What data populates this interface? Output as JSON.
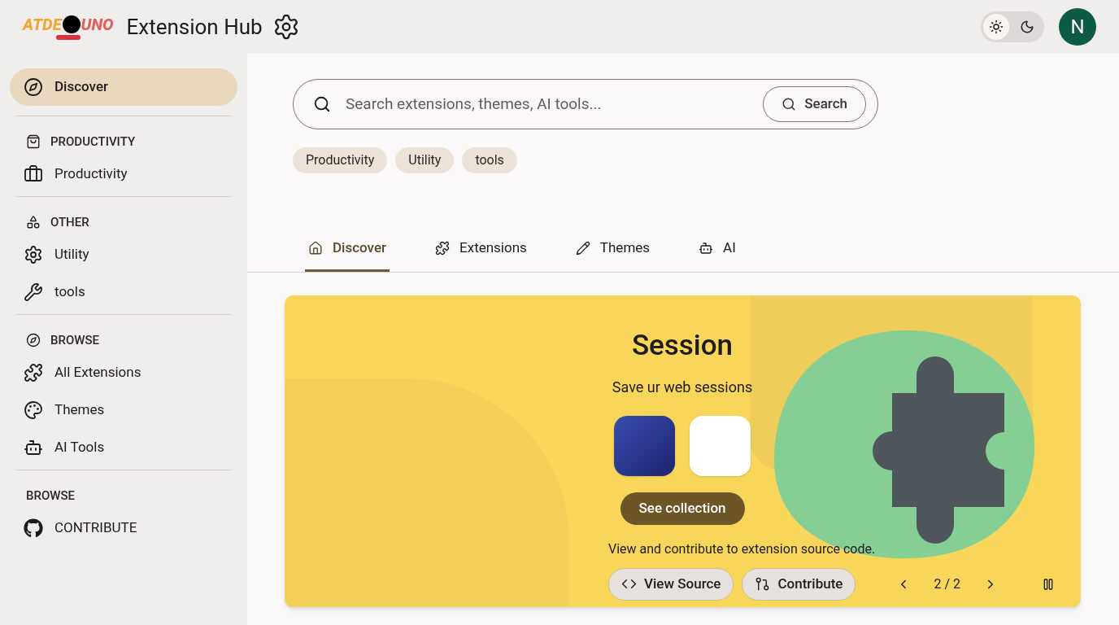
{
  "header": {
    "logo": {
      "left": "ATDE",
      "right": "UNO"
    },
    "title": "Extension Hub",
    "dark_mode": false,
    "avatar": "N"
  },
  "sidebar": {
    "sections": [
      {
        "items": [
          {
            "label": "Discover",
            "selected": true
          }
        ]
      },
      {
        "heading": "PRODUCTIVITY",
        "items": [
          {
            "label": "Productivity",
            "selected": false
          }
        ]
      },
      {
        "heading": "OTHER",
        "items": [
          {
            "label": "Utility",
            "selected": false
          },
          {
            "label": "tools",
            "selected": false
          }
        ]
      },
      {
        "heading": "BROWSE",
        "items": [
          {
            "label": "All Extensions",
            "selected": false
          },
          {
            "label": "Themes",
            "selected": false
          },
          {
            "label": "AI Tools",
            "selected": false
          }
        ]
      },
      {
        "heading": "BROWSE",
        "items": [
          {
            "label": "CONTRIBUTE",
            "selected": false
          }
        ]
      }
    ]
  },
  "search": {
    "placeholder": "Search extensions, themes, AI tools...",
    "button": "Search"
  },
  "chips": [
    "Productivity",
    "Utility",
    "tools"
  ],
  "tabs": [
    {
      "label": "Discover",
      "selected": true
    },
    {
      "label": "Extensions",
      "selected": false
    },
    {
      "label": "Themes",
      "selected": false
    },
    {
      "label": "AI",
      "selected": false
    }
  ],
  "carousel": {
    "title": "Session",
    "subtitle": "Save ur web sessions",
    "cta": "See collection",
    "note": "View and contribute to extension source code.",
    "buttons": [
      "View Source",
      "Contribute"
    ],
    "pager": "2 / 2",
    "playing": true
  }
}
